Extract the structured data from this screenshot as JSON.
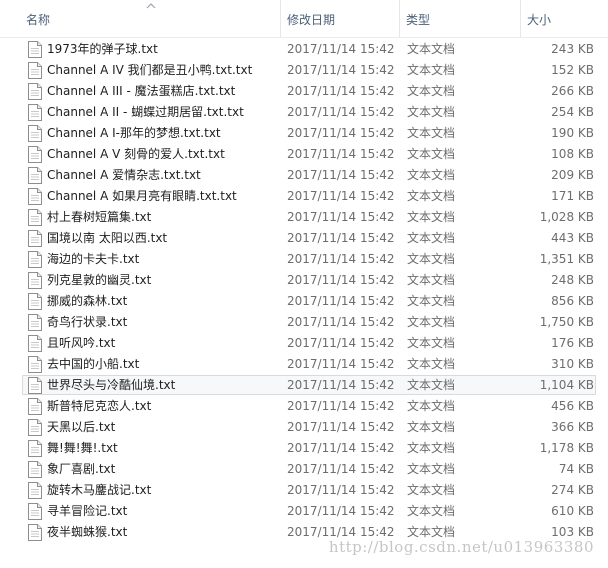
{
  "columns": {
    "name": "名称",
    "date": "修改日期",
    "type": "类型",
    "size": "大小"
  },
  "files": [
    {
      "name": "1973年的弹子球.txt",
      "date": "2017/11/14 15:42",
      "type": "文本文档",
      "size": "243 KB"
    },
    {
      "name": "Channel A IV 我们都是丑小鸭.txt.txt",
      "date": "2017/11/14 15:42",
      "type": "文本文档",
      "size": "152 KB"
    },
    {
      "name": "Channel A III - 魔法蛋糕店.txt.txt",
      "date": "2017/11/14 15:42",
      "type": "文本文档",
      "size": "266 KB"
    },
    {
      "name": "Channel A II - 蝴蝶过期居留.txt.txt",
      "date": "2017/11/14 15:42",
      "type": "文本文档",
      "size": "254 KB"
    },
    {
      "name": "Channel A I-那年的梦想.txt.txt",
      "date": "2017/11/14 15:42",
      "type": "文本文档",
      "size": "190 KB"
    },
    {
      "name": "Channel A V 刻骨的爱人.txt.txt",
      "date": "2017/11/14 15:42",
      "type": "文本文档",
      "size": "108 KB"
    },
    {
      "name": "Channel A 爱情杂志.txt.txt",
      "date": "2017/11/14 15:42",
      "type": "文本文档",
      "size": "209 KB"
    },
    {
      "name": "Channel A 如果月亮有眼睛.txt.txt",
      "date": "2017/11/14 15:42",
      "type": "文本文档",
      "size": "171 KB"
    },
    {
      "name": "村上春树短篇集.txt",
      "date": "2017/11/14 15:42",
      "type": "文本文档",
      "size": "1,028 KB"
    },
    {
      "name": "国境以南 太阳以西.txt",
      "date": "2017/11/14 15:42",
      "type": "文本文档",
      "size": "443 KB"
    },
    {
      "name": "海边的卡夫卡.txt",
      "date": "2017/11/14 15:42",
      "type": "文本文档",
      "size": "1,351 KB"
    },
    {
      "name": "列克星敦的幽灵.txt",
      "date": "2017/11/14 15:42",
      "type": "文本文档",
      "size": "248 KB"
    },
    {
      "name": "挪威的森林.txt",
      "date": "2017/11/14 15:42",
      "type": "文本文档",
      "size": "856 KB"
    },
    {
      "name": "奇鸟行状录.txt",
      "date": "2017/11/14 15:42",
      "type": "文本文档",
      "size": "1,750 KB"
    },
    {
      "name": "且听风吟.txt",
      "date": "2017/11/14 15:42",
      "type": "文本文档",
      "size": "176 KB"
    },
    {
      "name": "去中国的小船.txt",
      "date": "2017/11/14 15:42",
      "type": "文本文档",
      "size": "310 KB"
    },
    {
      "name": "世界尽头与冷酷仙境.txt",
      "date": "2017/11/14 15:42",
      "type": "文本文档",
      "size": "1,104 KB",
      "selected": true
    },
    {
      "name": "斯普特尼克恋人.txt",
      "date": "2017/11/14 15:42",
      "type": "文本文档",
      "size": "456 KB"
    },
    {
      "name": "天黑以后.txt",
      "date": "2017/11/14 15:42",
      "type": "文本文档",
      "size": "366 KB"
    },
    {
      "name": "舞!舞!舞!.txt",
      "date": "2017/11/14 15:42",
      "type": "文本文档",
      "size": "1,178 KB"
    },
    {
      "name": "象厂喜剧.txt",
      "date": "2017/11/14 15:42",
      "type": "文本文档",
      "size": "74 KB"
    },
    {
      "name": "旋转木马鏖战记.txt",
      "date": "2017/11/14 15:42",
      "type": "文本文档",
      "size": "274 KB"
    },
    {
      "name": "寻羊冒险记.txt",
      "date": "2017/11/14 15:42",
      "type": "文本文档",
      "size": "610 KB"
    },
    {
      "name": "夜半蜘蛛猴.txt",
      "date": "2017/11/14 15:42",
      "type": "文本文档",
      "size": "103 KB"
    }
  ],
  "watermark": "http://blog.csdn.net/u013963380",
  "icons": {
    "file": "text-document-icon",
    "sort": "sort-ascending-icon"
  },
  "colors": {
    "header_text": "#4c607a",
    "selection_border": "#d9d9d9",
    "secondary_text": "#6d6d6d"
  }
}
